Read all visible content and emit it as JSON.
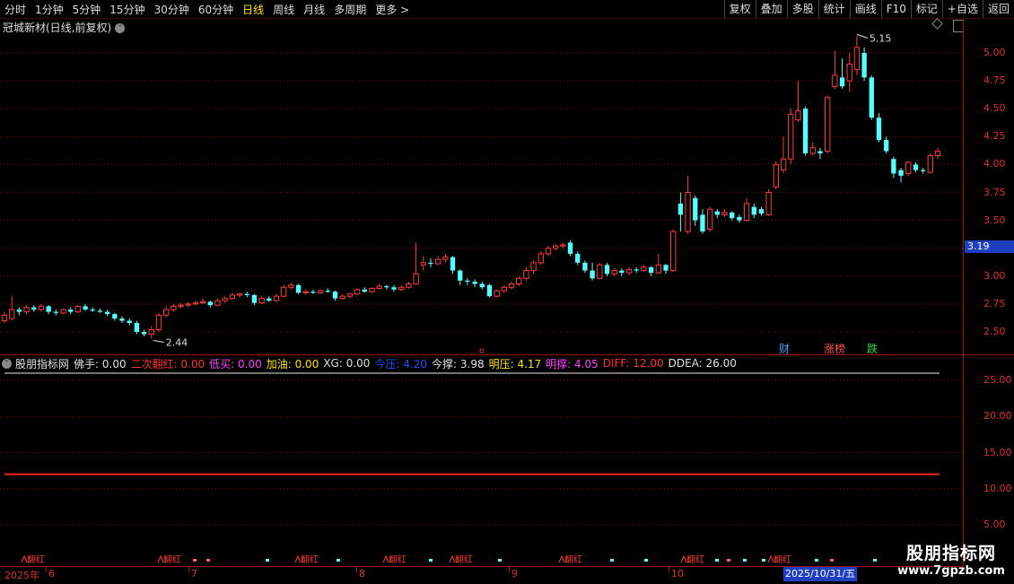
{
  "toolbar": {
    "periods": [
      "分时",
      "1分钟",
      "5分钟",
      "15分钟",
      "30分钟",
      "60分钟",
      "日线",
      "周线",
      "月线",
      "多周期",
      "更多 >"
    ],
    "active_index": 6,
    "right_buttons": [
      "复权",
      "叠加",
      "多股",
      "统计",
      "画线",
      "F10",
      "标记",
      "+自选",
      "返回"
    ]
  },
  "stock": {
    "title": "冠城新材(日线,前复权)"
  },
  "price_axis": [
    "5.00",
    "4.75",
    "4.50",
    "4.25",
    "4.00",
    "3.75",
    "3.50",
    "3.25",
    "3.00",
    "2.75",
    "2.50"
  ],
  "current_price": "3.19",
  "annotations": {
    "high": "5.15",
    "low": "2.44"
  },
  "event_markers": [
    {
      "text": "财",
      "color": "#3aa0ff"
    },
    {
      "text": "涨榜",
      "color": "#ff5050"
    },
    {
      "text": "跌",
      "color": "#30e030"
    }
  ],
  "indicator": {
    "name": "股朋指标网",
    "items": [
      {
        "text": "佛手: 0.00",
        "color": "#e0e0e0"
      },
      {
        "text": "二次翻红: 0.00",
        "color": "#ff3030"
      },
      {
        "text": "低买: 0.00",
        "color": "#ff40ff"
      },
      {
        "text": "加油: 0.00",
        "color": "#ffe600"
      },
      {
        "text": "XG: 0.00",
        "color": "#e0e0e0"
      },
      {
        "text": "今压: 4.20",
        "color": "#2050ff"
      },
      {
        "text": "今撑: 3.98",
        "color": "#e0e0e0"
      },
      {
        "text": "明压: 4.17",
        "color": "#ffe600"
      },
      {
        "text": "明撑: 4.05",
        "color": "#ff40ff"
      },
      {
        "text": "DIFF: 12.00",
        "color": "#ff3030"
      },
      {
        "text": "DDEA: 26.00",
        "color": "#e0e0e0"
      }
    ]
  },
  "indicator_axis": [
    "25.00",
    "20.00",
    "15.00",
    "10.00",
    "5.00"
  ],
  "signal_label": "翻红",
  "date_axis": {
    "labels": [
      {
        "text": "2025年",
        "x": 5
      },
      {
        "text": "6",
        "x": 54
      },
      {
        "text": "7",
        "x": 213
      },
      {
        "text": "8",
        "x": 400
      },
      {
        "text": "9",
        "x": 570
      },
      {
        "text": "10",
        "x": 748
      }
    ],
    "selected": "2025/10/31/五"
  },
  "watermark": {
    "title": "股朋指标网",
    "url": "www.7gpzb.com"
  },
  "chart_data": {
    "type": "candlestick",
    "series": [
      {
        "o": 2.6,
        "c": 2.65,
        "h": 2.68,
        "l": 2.58
      },
      {
        "o": 2.62,
        "c": 2.7,
        "h": 2.82,
        "l": 2.6
      },
      {
        "o": 2.7,
        "c": 2.68,
        "h": 2.72,
        "l": 2.65
      },
      {
        "o": 2.68,
        "c": 2.72,
        "h": 2.74,
        "l": 2.66
      },
      {
        "o": 2.72,
        "c": 2.7,
        "h": 2.74,
        "l": 2.68
      },
      {
        "o": 2.7,
        "c": 2.73,
        "h": 2.75,
        "l": 2.68
      },
      {
        "o": 2.73,
        "c": 2.68,
        "h": 2.74,
        "l": 2.66
      },
      {
        "o": 2.68,
        "c": 2.67,
        "h": 2.7,
        "l": 2.65
      },
      {
        "o": 2.67,
        "c": 2.7,
        "h": 2.71,
        "l": 2.66
      },
      {
        "o": 2.7,
        "c": 2.68,
        "h": 2.72,
        "l": 2.66
      },
      {
        "o": 2.68,
        "c": 2.73,
        "h": 2.74,
        "l": 2.67
      },
      {
        "o": 2.73,
        "c": 2.7,
        "h": 2.75,
        "l": 2.69
      },
      {
        "o": 2.7,
        "c": 2.69,
        "h": 2.72,
        "l": 2.68
      },
      {
        "o": 2.69,
        "c": 2.68,
        "h": 2.71,
        "l": 2.67
      },
      {
        "o": 2.68,
        "c": 2.66,
        "h": 2.7,
        "l": 2.64
      },
      {
        "o": 2.66,
        "c": 2.62,
        "h": 2.67,
        "l": 2.6
      },
      {
        "o": 2.62,
        "c": 2.6,
        "h": 2.64,
        "l": 2.58
      },
      {
        "o": 2.6,
        "c": 2.58,
        "h": 2.62,
        "l": 2.56
      },
      {
        "o": 2.58,
        "c": 2.5,
        "h": 2.6,
        "l": 2.48
      },
      {
        "o": 2.5,
        "c": 2.48,
        "h": 2.52,
        "l": 2.46
      },
      {
        "o": 2.48,
        "c": 2.52,
        "h": 2.55,
        "l": 2.44
      },
      {
        "o": 2.52,
        "c": 2.65,
        "h": 2.67,
        "l": 2.5
      },
      {
        "o": 2.65,
        "c": 2.7,
        "h": 2.73,
        "l": 2.63
      },
      {
        "o": 2.7,
        "c": 2.73,
        "h": 2.75,
        "l": 2.68
      },
      {
        "o": 2.73,
        "c": 2.74,
        "h": 2.76,
        "l": 2.71
      },
      {
        "o": 2.74,
        "c": 2.75,
        "h": 2.77,
        "l": 2.72
      },
      {
        "o": 2.75,
        "c": 2.76,
        "h": 2.78,
        "l": 2.74
      },
      {
        "o": 2.76,
        "c": 2.77,
        "h": 2.8,
        "l": 2.75
      },
      {
        "o": 2.77,
        "c": 2.74,
        "h": 2.78,
        "l": 2.72
      },
      {
        "o": 2.74,
        "c": 2.78,
        "h": 2.8,
        "l": 2.73
      },
      {
        "o": 2.78,
        "c": 2.8,
        "h": 2.82,
        "l": 2.76
      },
      {
        "o": 2.8,
        "c": 2.83,
        "h": 2.85,
        "l": 2.79
      },
      {
        "o": 2.83,
        "c": 2.84,
        "h": 2.85,
        "l": 2.81
      },
      {
        "o": 2.84,
        "c": 2.83,
        "h": 2.86,
        "l": 2.81
      },
      {
        "o": 2.83,
        "c": 2.76,
        "h": 2.84,
        "l": 2.74
      },
      {
        "o": 2.76,
        "c": 2.8,
        "h": 2.82,
        "l": 2.75
      },
      {
        "o": 2.8,
        "c": 2.78,
        "h": 2.82,
        "l": 2.77
      },
      {
        "o": 2.78,
        "c": 2.82,
        "h": 2.84,
        "l": 2.77
      },
      {
        "o": 2.82,
        "c": 2.9,
        "h": 2.92,
        "l": 2.81
      },
      {
        "o": 2.9,
        "c": 2.92,
        "h": 2.94,
        "l": 2.88
      },
      {
        "o": 2.92,
        "c": 2.85,
        "h": 2.93,
        "l": 2.84
      },
      {
        "o": 2.85,
        "c": 2.86,
        "h": 2.88,
        "l": 2.84
      },
      {
        "o": 2.86,
        "c": 2.85,
        "h": 2.88,
        "l": 2.84
      },
      {
        "o": 2.85,
        "c": 2.87,
        "h": 2.88,
        "l": 2.84
      },
      {
        "o": 2.87,
        "c": 2.86,
        "h": 2.89,
        "l": 2.85
      },
      {
        "o": 2.86,
        "c": 2.8,
        "h": 2.87,
        "l": 2.78
      },
      {
        "o": 2.8,
        "c": 2.82,
        "h": 2.84,
        "l": 2.79
      },
      {
        "o": 2.82,
        "c": 2.84,
        "h": 2.85,
        "l": 2.8
      },
      {
        "o": 2.84,
        "c": 2.88,
        "h": 2.89,
        "l": 2.83
      },
      {
        "o": 2.88,
        "c": 2.86,
        "h": 2.9,
        "l": 2.85
      },
      {
        "o": 2.86,
        "c": 2.89,
        "h": 2.9,
        "l": 2.85
      },
      {
        "o": 2.89,
        "c": 2.91,
        "h": 2.93,
        "l": 2.88
      },
      {
        "o": 2.91,
        "c": 2.9,
        "h": 2.92,
        "l": 2.88
      },
      {
        "o": 2.9,
        "c": 2.88,
        "h": 2.92,
        "l": 2.86
      },
      {
        "o": 2.88,
        "c": 2.9,
        "h": 2.92,
        "l": 2.87
      },
      {
        "o": 2.9,
        "c": 2.93,
        "h": 2.95,
        "l": 2.89
      },
      {
        "o": 2.93,
        "c": 3.02,
        "h": 3.3,
        "l": 2.93
      },
      {
        "o": 3.1,
        "c": 3.12,
        "h": 3.18,
        "l": 3.05
      },
      {
        "o": 3.12,
        "c": 3.11,
        "h": 3.16,
        "l": 3.08
      },
      {
        "o": 3.11,
        "c": 3.15,
        "h": 3.18,
        "l": 3.1
      },
      {
        "o": 3.15,
        "c": 3.17,
        "h": 3.2,
        "l": 3.12
      },
      {
        "o": 3.17,
        "c": 3.05,
        "h": 3.18,
        "l": 3.02
      },
      {
        "o": 3.05,
        "c": 2.96,
        "h": 3.06,
        "l": 2.92
      },
      {
        "o": 2.96,
        "c": 2.95,
        "h": 2.98,
        "l": 2.92
      },
      {
        "o": 2.95,
        "c": 2.93,
        "h": 2.97,
        "l": 2.9
      },
      {
        "o": 2.93,
        "c": 2.9,
        "h": 2.95,
        "l": 2.88
      },
      {
        "o": 2.92,
        "c": 2.82,
        "h": 2.93,
        "l": 2.81
      },
      {
        "o": 2.82,
        "c": 2.87,
        "h": 2.88,
        "l": 2.81
      },
      {
        "o": 2.87,
        "c": 2.9,
        "h": 2.92,
        "l": 2.85
      },
      {
        "o": 2.9,
        "c": 2.93,
        "h": 2.95,
        "l": 2.88
      },
      {
        "o": 2.93,
        "c": 2.98,
        "h": 3.0,
        "l": 2.91
      },
      {
        "o": 2.98,
        "c": 3.05,
        "h": 3.08,
        "l": 2.96
      },
      {
        "o": 3.05,
        "c": 3.12,
        "h": 3.14,
        "l": 3.02
      },
      {
        "o": 3.12,
        "c": 3.2,
        "h": 3.22,
        "l": 3.1
      },
      {
        "o": 3.2,
        "c": 3.25,
        "h": 3.27,
        "l": 3.18
      },
      {
        "o": 3.25,
        "c": 3.27,
        "h": 3.29,
        "l": 3.23
      },
      {
        "o": 3.27,
        "c": 3.28,
        "h": 3.3,
        "l": 3.25
      },
      {
        "o": 3.3,
        "c": 3.2,
        "h": 3.32,
        "l": 3.18
      },
      {
        "o": 3.2,
        "c": 3.12,
        "h": 3.22,
        "l": 3.1
      },
      {
        "o": 3.12,
        "c": 3.05,
        "h": 3.14,
        "l": 3.03
      },
      {
        "o": 3.05,
        "c": 2.98,
        "h": 3.12,
        "l": 2.96
      },
      {
        "o": 2.98,
        "c": 3.1,
        "h": 3.12,
        "l": 2.97
      },
      {
        "o": 3.1,
        "c": 3.02,
        "h": 3.12,
        "l": 3.0
      },
      {
        "o": 3.02,
        "c": 3.05,
        "h": 3.07,
        "l": 3.0
      },
      {
        "o": 3.05,
        "c": 3.03,
        "h": 3.07,
        "l": 3.0
      },
      {
        "o": 3.03,
        "c": 3.06,
        "h": 3.08,
        "l": 3.01
      },
      {
        "o": 3.06,
        "c": 3.05,
        "h": 3.08,
        "l": 3.03
      },
      {
        "o": 3.05,
        "c": 3.08,
        "h": 3.1,
        "l": 3.04
      },
      {
        "o": 3.08,
        "c": 3.03,
        "h": 3.09,
        "l": 3.0
      },
      {
        "o": 3.03,
        "c": 3.1,
        "h": 3.2,
        "l": 3.02
      },
      {
        "o": 3.1,
        "c": 3.05,
        "h": 3.11,
        "l": 3.02
      },
      {
        "o": 3.05,
        "c": 3.4,
        "h": 3.42,
        "l": 3.04
      },
      {
        "o": 3.65,
        "c": 3.55,
        "h": 3.75,
        "l": 3.4
      },
      {
        "o": 3.4,
        "c": 3.75,
        "h": 3.9,
        "l": 3.38
      },
      {
        "o": 3.7,
        "c": 3.5,
        "h": 3.72,
        "l": 3.45
      },
      {
        "o": 3.55,
        "c": 3.4,
        "h": 3.6,
        "l": 3.38
      },
      {
        "o": 3.42,
        "c": 3.6,
        "h": 3.62,
        "l": 3.4
      },
      {
        "o": 3.58,
        "c": 3.55,
        "h": 3.6,
        "l": 3.52
      },
      {
        "o": 3.55,
        "c": 3.57,
        "h": 3.6,
        "l": 3.53
      },
      {
        "o": 3.57,
        "c": 3.52,
        "h": 3.58,
        "l": 3.5
      },
      {
        "o": 3.53,
        "c": 3.5,
        "h": 3.55,
        "l": 3.48
      },
      {
        "o": 3.5,
        "c": 3.65,
        "h": 3.7,
        "l": 3.49
      },
      {
        "o": 3.62,
        "c": 3.55,
        "h": 3.65,
        "l": 3.52
      },
      {
        "o": 3.6,
        "c": 3.56,
        "h": 3.62,
        "l": 3.54
      },
      {
        "o": 3.55,
        "c": 3.75,
        "h": 3.78,
        "l": 3.54
      },
      {
        "o": 3.8,
        "c": 4.0,
        "h": 4.03,
        "l": 3.78
      },
      {
        "o": 3.95,
        "c": 4.05,
        "h": 4.25,
        "l": 3.92
      },
      {
        "o": 4.05,
        "c": 4.45,
        "h": 4.5,
        "l": 4.0
      },
      {
        "o": 4.4,
        "c": 4.48,
        "h": 4.75,
        "l": 4.38
      },
      {
        "o": 4.5,
        "c": 4.1,
        "h": 4.52,
        "l": 4.08
      },
      {
        "o": 4.1,
        "c": 4.15,
        "h": 4.2,
        "l": 4.08
      },
      {
        "o": 4.12,
        "c": 4.1,
        "h": 4.15,
        "l": 4.05
      },
      {
        "o": 4.12,
        "c": 4.6,
        "h": 4.62,
        "l": 4.1
      },
      {
        "o": 4.7,
        "c": 4.8,
        "h": 5.02,
        "l": 4.68
      },
      {
        "o": 4.78,
        "c": 4.7,
        "h": 4.95,
        "l": 4.68
      },
      {
        "o": 4.75,
        "c": 4.9,
        "h": 5.0,
        "l": 4.65
      },
      {
        "o": 4.85,
        "c": 5.05,
        "h": 5.15,
        "l": 4.8
      },
      {
        "o": 5.0,
        "c": 4.78,
        "h": 5.05,
        "l": 4.75
      },
      {
        "o": 4.78,
        "c": 4.42,
        "h": 4.8,
        "l": 4.4
      },
      {
        "o": 4.42,
        "c": 4.22,
        "h": 4.46,
        "l": 4.2
      },
      {
        "o": 4.22,
        "c": 4.12,
        "h": 4.25,
        "l": 4.1
      },
      {
        "o": 4.05,
        "c": 3.92,
        "h": 4.07,
        "l": 3.88
      },
      {
        "o": 3.95,
        "c": 3.9,
        "h": 3.97,
        "l": 3.84
      },
      {
        "o": 3.92,
        "c": 4.02,
        "h": 4.03,
        "l": 3.9
      },
      {
        "o": 4.0,
        "c": 3.95,
        "h": 4.02,
        "l": 3.93
      },
      {
        "o": 3.95,
        "c": 3.94,
        "h": 3.97,
        "l": 3.92
      },
      {
        "o": 3.93,
        "c": 4.08,
        "h": 4.1,
        "l": 3.92
      },
      {
        "o": 4.08,
        "c": 4.12,
        "h": 4.15,
        "l": 4.05
      }
    ]
  }
}
